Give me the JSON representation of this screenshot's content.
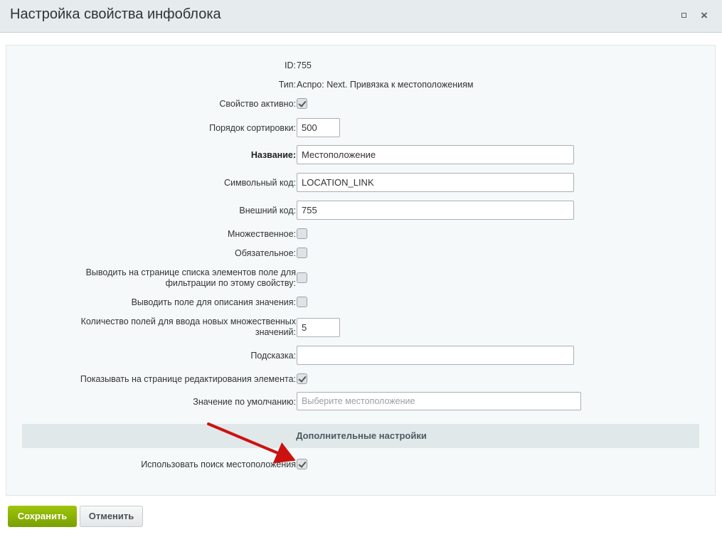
{
  "window": {
    "title": "Настройка свойства инфоблока",
    "maximize_icon": "maximize-icon",
    "close_icon": "close-icon",
    "close_glyph": "×"
  },
  "form": {
    "id": {
      "label": "ID:",
      "value": "755"
    },
    "type": {
      "label": "Тип:",
      "value": "Аспро: Next. Привязка к местоположениям"
    },
    "active": {
      "label": "Свойство активно:",
      "checked": true
    },
    "sort": {
      "label": "Порядок сортировки:",
      "value": "500"
    },
    "name": {
      "label": "Название:",
      "value": "Местоположение"
    },
    "code": {
      "label": "Символьный код:",
      "value": "LOCATION_LINK"
    },
    "xml_id": {
      "label": "Внешний код:",
      "value": "755"
    },
    "multiple": {
      "label": "Множественное:",
      "checked": false
    },
    "required": {
      "label": "Обязательное:",
      "checked": false
    },
    "filtrable": {
      "label": "Выводить на странице списка элементов поле для фильтрации по этому свойству:",
      "checked": false
    },
    "with_description": {
      "label": "Выводить поле для описания значения:",
      "checked": false
    },
    "multiple_cnt": {
      "label": "Количество полей для ввода новых множественных значений:",
      "value": "5"
    },
    "hint": {
      "label": "Подсказка:",
      "value": ""
    },
    "show_on_edit": {
      "label": "Показывать на странице редактирования элемента:",
      "checked": true
    },
    "default_value": {
      "label": "Значение по умолчанию:",
      "placeholder": "Выберите местоположение"
    }
  },
  "extra_section": {
    "title": "Дополнительные настройки",
    "use_search": {
      "label": "Использовать поиск местоположения",
      "checked": true
    }
  },
  "buttons": {
    "save": "Сохранить",
    "cancel": "Отменить"
  },
  "colors": {
    "save_button": "#86ad00",
    "annotation_arrow": "#cc1111"
  }
}
